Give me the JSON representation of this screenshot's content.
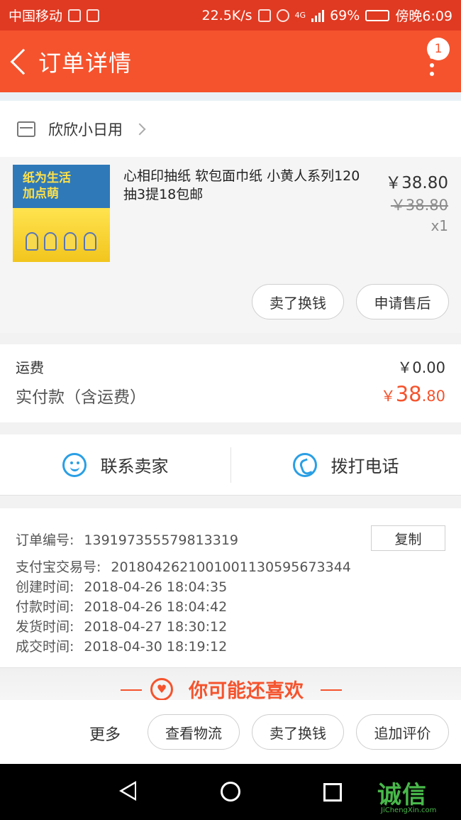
{
  "status_bar": {
    "carrier": "中国移动",
    "speed": "22.5K/s",
    "network": "4G",
    "battery": "69%",
    "battery_level": 0.69,
    "time": "傍晚6:09"
  },
  "header": {
    "title": "订单详情",
    "badge_count": "1"
  },
  "shop": {
    "name": "欣欣小日用"
  },
  "product": {
    "name": "心相印抽纸 软包面巾纸 小黄人系列120抽3提18包邮",
    "price": "￥38.80",
    "original_price": "￥38.80",
    "quantity": "x1",
    "image_slogan": "纸为生活\n加点萌",
    "actions": [
      "卖了换钱",
      "申请售后"
    ]
  },
  "costs": {
    "shipping_label": "运费",
    "shipping_value": "￥0.00",
    "paid_label": "实付款（含运费）",
    "paid_symbol": "￥",
    "paid_int": "38",
    "paid_dec": ".80"
  },
  "contact": {
    "seller": "联系卖家",
    "phone": "拨打电话"
  },
  "order_info": {
    "copy_label": "复制",
    "rows": [
      {
        "key": "订单编号:",
        "value": "139197355579813319"
      },
      {
        "key": "支付宝交易号:",
        "value": "2018042621001001130595673344"
      },
      {
        "key": "创建时间:",
        "value": "2018-04-26 18:04:35"
      },
      {
        "key": "付款时间:",
        "value": "2018-04-26 18:04:42"
      },
      {
        "key": "发货时间:",
        "value": "2018-04-27 18:30:12"
      },
      {
        "key": "成交时间:",
        "value": "2018-04-30 18:19:12"
      }
    ]
  },
  "recommend": {
    "title": "你可能还喜欢"
  },
  "bottom_bar": {
    "more": "更多",
    "buttons": [
      "查看物流",
      "卖了换钱",
      "追加评价"
    ]
  },
  "watermark": {
    "text": "诚信",
    "sub": "JiChengXin.com"
  },
  "colors": {
    "accent": "#f5532d",
    "status_bar": "#e03a22",
    "link_blue": "#2a9fe5"
  }
}
